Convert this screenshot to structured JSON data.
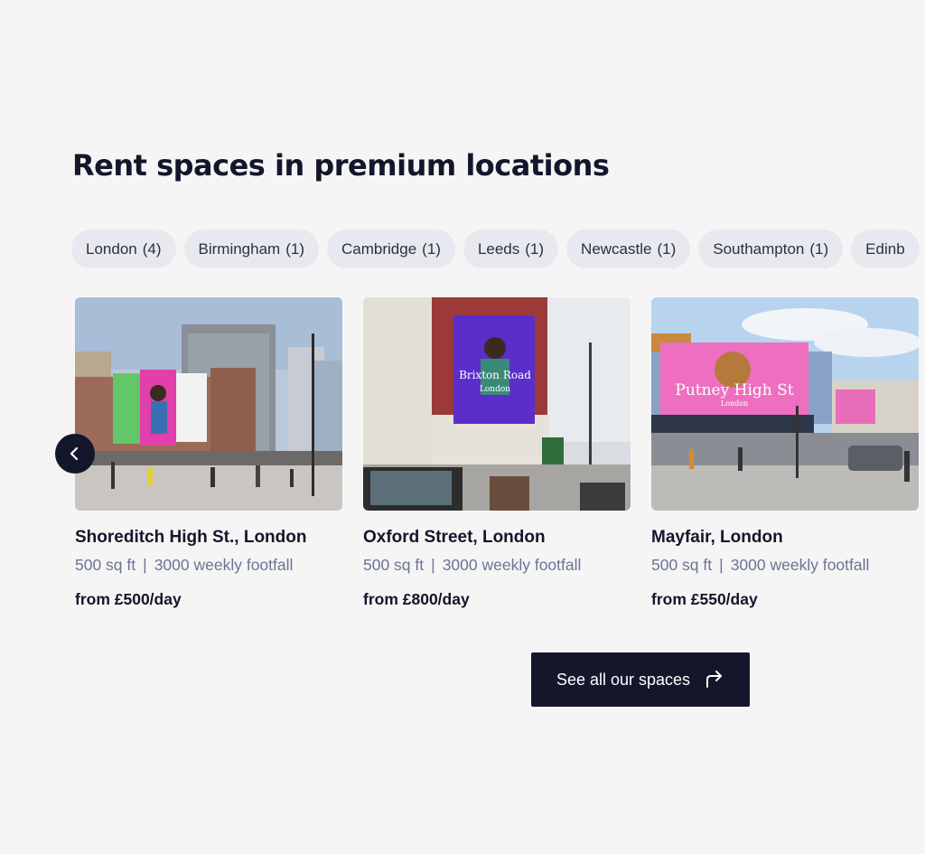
{
  "section": {
    "title": "Rent spaces in premium locations"
  },
  "filters": [
    {
      "label": "London",
      "count": "(4)"
    },
    {
      "label": "Birmingham",
      "count": "(1)"
    },
    {
      "label": "Cambridge",
      "count": "(1)"
    },
    {
      "label": "Leeds",
      "count": "(1)"
    },
    {
      "label": "Newcastle",
      "count": "(1)"
    },
    {
      "label": "Southampton",
      "count": "(1)"
    },
    {
      "label": "Edinb",
      "count": ""
    }
  ],
  "cards": [
    {
      "name": "Shoreditch High St., London",
      "size": "500 sq ft",
      "footfall": "3000 weekly footfall",
      "price": "from £500/day",
      "billboard_text": ""
    },
    {
      "name": "Oxford Street, London",
      "size": "500 sq ft",
      "footfall": "3000 weekly footfall",
      "price": "from £800/day",
      "billboard_text": "Brixton Road",
      "billboard_sub": "London"
    },
    {
      "name": "Mayfair, London",
      "size": "500 sq ft",
      "footfall": "3000 weekly footfall",
      "price": "from £550/day",
      "billboard_text": "Putney High St",
      "billboard_sub": "London"
    }
  ],
  "separator": "|",
  "cta": {
    "label": "See all our spaces",
    "icon": "share-arrow-icon"
  },
  "carousel": {
    "prev_icon": "chevron-left-icon"
  },
  "colors": {
    "primary": "#14162b",
    "chip_bg": "#e8e9ee",
    "muted": "#6b7591",
    "background": "#f5f5f5"
  }
}
